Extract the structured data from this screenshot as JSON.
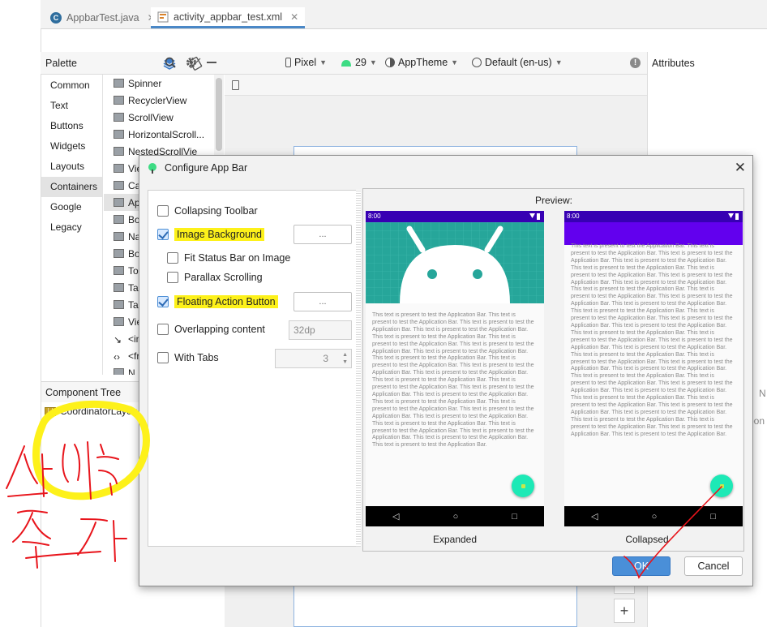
{
  "tabs": [
    {
      "label": "AppbarTest.java"
    },
    {
      "label": "activity_appbar_test.xml"
    }
  ],
  "palette": {
    "title": "Palette",
    "categories": [
      "Common",
      "Text",
      "Buttons",
      "Widgets",
      "Layouts",
      "Containers",
      "Google",
      "Legacy"
    ],
    "selected_category": "Containers",
    "items": [
      "Spinner",
      "RecyclerView",
      "ScrollView",
      "HorizontalScroll...",
      "NestedScrollVie",
      "Vie",
      "Ca",
      "Ap",
      "Bo",
      "Na",
      "Bo",
      "To",
      "Tal",
      "Tal",
      "Vie",
      "<in",
      "<fr",
      "N"
    ]
  },
  "component_tree": {
    "title": "Component Tree",
    "root": "CoordinatorLayou"
  },
  "design_toolbar": {
    "device": "Pixel",
    "api": "29",
    "theme": "AppTheme",
    "locale": "Default (en-us)"
  },
  "attributes": {
    "title": "Attributes",
    "edge_text_1": "N",
    "edge_text_2": "pon"
  },
  "dialog": {
    "title": "Configure App Bar",
    "options": {
      "collapsing_toolbar": {
        "label": "Collapsing Toolbar",
        "checked": false
      },
      "image_background": {
        "label": "Image Background",
        "checked": true,
        "button": "..."
      },
      "fit_status_bar": {
        "label": "Fit Status Bar on Image",
        "checked": false
      },
      "parallax_scrolling": {
        "label": "Parallax Scrolling",
        "checked": false
      },
      "floating_action_button": {
        "label": "Floating Action Button",
        "checked": true,
        "button": "..."
      },
      "overlapping_content": {
        "label": "Overlapping content",
        "checked": false,
        "value": "32dp"
      },
      "with_tabs": {
        "label": "With Tabs",
        "checked": false,
        "value": "3"
      }
    },
    "preview_label": "Preview:",
    "expanded": {
      "status_time": "8:00",
      "body": "This text is present to test the Application Bar. This text is present to test the Application Bar. This text is present to test the Application Bar. This text is present to test the Application Bar. This text is present to test the Application Bar. This text is present to test the Application Bar. This text is present to test the Application Bar. This text is present to test the Application Bar. This text is present to test the Application Bar. This text is present to test the Application Bar. This text is present to test the Application Bar. This text is present to test the Application Bar. This text is present to test the Application Bar. This text is present to test the Application Bar. This text is present to test the Application Bar. This text is present to test the Application Bar. This text is present to test the Application Bar. This text is present to test the Application Bar. This text is present to test the Application Bar. This text is present to test the Application Bar. This text is present to test the Application Bar. This text is present to test the Application Bar. This text is present to test the Application Bar. This text is present to test the Application Bar. This text is present to test the Application Bar.",
      "caption": "Expanded"
    },
    "collapsed": {
      "status_time": "8:00",
      "body": "This text is present to test the Application Bar. This text is present to test the Application Bar. This text is present to test the Application Bar. This text is present to test the Application Bar. This text is present to test the Application Bar. This text is present to test the Application Bar. This text is present to test the Application Bar. This text is present to test the Application Bar. This text is present to test the Application Bar. This text is present to test the Application Bar. This text is present to test the Application Bar. This text is present to test the Application Bar. This text is present to test the Application Bar. This text is present to test the Application Bar. This text is present to test the Application Bar. This text is present to test the Application Bar. This text is present to test the Application Bar. This text is present to test the Application Bar. This text is present to test the Application Bar. This text is present to test the Application Bar. This text is present to test the Application Bar. This text is present to test the Application Bar. This text is present to test the Application Bar. This text is present to test the Application Bar. This text is present to test the Application Bar. This text is present to test the Application Bar. This text is present to test the Application Bar. This text is present to test the Application Bar. This text is present to test the Application Bar. This text is present to test the Application Bar. This text is present to test the Application Bar. This text is present to test the Application Bar. This text is present to test the Application Bar. This text is present to test the Application Bar. This text is present to test the Application Bar. This text is present to test the Application Bar.",
      "caption": "Collapsed"
    },
    "ok_label": "OK",
    "cancel_label": "Cancel"
  },
  "annotations": {
    "handwriting_line1": "삭제 후",
    "handwriting_line2": "추가"
  },
  "colors": {
    "status_bar": "#3700b3",
    "collapsed_appbar": "#6200ee",
    "image_bg": "#26a69a",
    "fab": "#1de9b6",
    "highlight": "#fdf11a",
    "ok_button": "#4a8fd8",
    "annotation_red": "#e8141b"
  }
}
